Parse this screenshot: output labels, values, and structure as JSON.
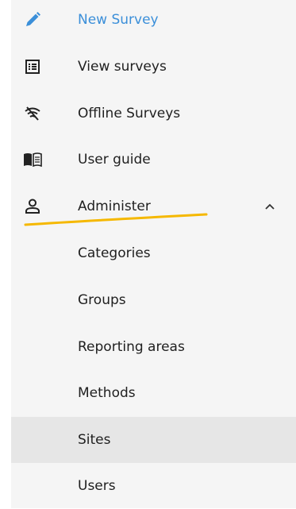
{
  "menu": {
    "items": [
      {
        "label": "New Survey",
        "icon": "pencil-icon"
      },
      {
        "label": "View surveys",
        "icon": "list-icon"
      },
      {
        "label": "Offline Surveys",
        "icon": "wifi-off-icon"
      },
      {
        "label": "User guide",
        "icon": "book-icon"
      },
      {
        "label": "Administer",
        "icon": "person-icon"
      }
    ],
    "administer_submenu": [
      {
        "label": "Categories"
      },
      {
        "label": "Groups"
      },
      {
        "label": "Reporting areas"
      },
      {
        "label": "Methods"
      },
      {
        "label": "Sites"
      },
      {
        "label": "Users"
      }
    ]
  },
  "colors": {
    "accent": "#3b8fd9",
    "highlight_stroke": "#f5b800",
    "selected_bg": "#e6e6e6"
  }
}
